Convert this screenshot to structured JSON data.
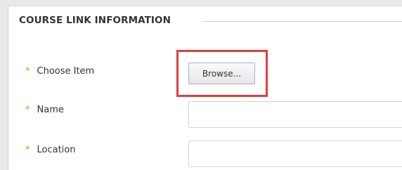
{
  "section": {
    "title": "COURSE LINK INFORMATION"
  },
  "required_marker": "*",
  "fields": {
    "choose_item": {
      "label": "Choose Item",
      "button_label": "Browse..."
    },
    "name": {
      "label": "Name",
      "value": "",
      "placeholder": ""
    },
    "location": {
      "label": "Location",
      "value": "",
      "placeholder": ""
    }
  },
  "colors": {
    "required_marker": "#e58a33",
    "highlight_box": "#e23c3c",
    "button_border": "#9eb3d3",
    "panel_background": "#ffffff",
    "page_background": "#e9e9e9"
  }
}
